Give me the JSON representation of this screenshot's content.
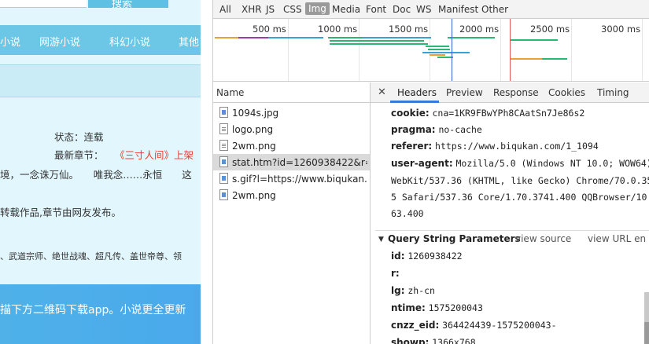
{
  "site": {
    "search_button": "搜索",
    "nav": [
      "小说",
      "网游小说",
      "科幻小说",
      "其他"
    ],
    "status": "状态：连载",
    "latest_label": "最新章节：",
    "latest_title": "《三寸人间》上架",
    "intro_line": "境，一念诛万仙。　　唯我念……永恒　　这",
    "repost": "转载作品,章节由网友发布。",
    "related": "、武道宗师、绝世战魂、超凡传、盖世帝尊、领",
    "footer_text": "描下方二维码下载app。小说更全更新"
  },
  "devtools": {
    "filters": [
      "All",
      "XHR",
      "JS",
      "CSS",
      "Img",
      "Media",
      "Font",
      "Doc",
      "WS",
      "Manifest",
      "Other"
    ],
    "active_filter": "Img",
    "timeline_ticks": [
      "500 ms",
      "1000 ms",
      "1500 ms",
      "2000 ms",
      "2500 ms",
      "3000 ms"
    ],
    "name_header": "Name",
    "files": [
      {
        "name": "1094s.jpg",
        "icon": "image-file-icon"
      },
      {
        "name": "logo.png",
        "icon": "document-file-icon"
      },
      {
        "name": "2wm.png",
        "icon": "document-file-icon"
      },
      {
        "name": "stat.htm?id=1260938422&r=&...",
        "icon": "image-file-icon",
        "selected": true
      },
      {
        "name": "s.gif?l=https://www.biqukan.c...",
        "icon": "image-file-icon"
      },
      {
        "name": "2wm.png",
        "icon": "image-file-icon"
      }
    ],
    "tabs": [
      "Headers",
      "Preview",
      "Response",
      "Cookies",
      "Timing"
    ],
    "active_tab": "Headers",
    "headers": [
      {
        "key": "cookie:",
        "value": "cna=1KR9FBwYPh8CAatSn7Je86s2"
      },
      {
        "key": "pragma:",
        "value": "no-cache"
      },
      {
        "key": "referer:",
        "value": "https://www.biqukan.com/1_1094"
      },
      {
        "key": "user-agent:",
        "value": "Mozilla/5.0 (Windows NT 10.0; WOW64)"
      }
    ],
    "user_agent_continued": [
      "WebKit/537.36 (KHTML, like Gecko) Chrome/70.0.35",
      "5 Safari/537.36 Core/1.70.3741.400 QQBrowser/10",
      "63.400"
    ],
    "query_section": {
      "title": "Query String Parameters",
      "view_source": "view source",
      "view_url": "view URL en"
    },
    "params": [
      {
        "key": "id:",
        "value": "1260938422"
      },
      {
        "key": "r:",
        "value": ""
      },
      {
        "key": "lg:",
        "value": "zh-cn"
      },
      {
        "key": "ntime:",
        "value": "1575200043"
      },
      {
        "key": "cnzz_eid:",
        "value": "364424439-1575200043-"
      },
      {
        "key": "showp:",
        "value": "1366x768"
      }
    ]
  }
}
